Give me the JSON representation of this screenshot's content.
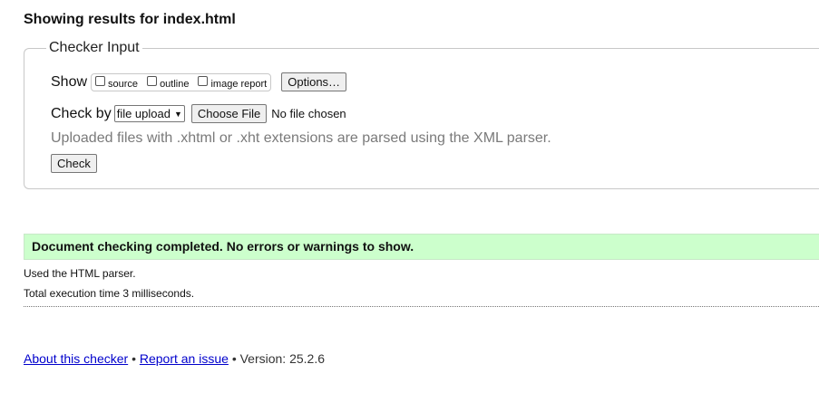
{
  "results_title": "Showing results for index.html",
  "checker_input": {
    "legend": "Checker Input",
    "show_label": "Show",
    "show_options": [
      {
        "label": "source",
        "checked": false
      },
      {
        "label": "outline",
        "checked": false
      },
      {
        "label": "image report",
        "checked": false
      }
    ],
    "options_button": "Options…",
    "check_by_label": "Check by",
    "check_by_selected": "file upload",
    "choose_file_button": "Choose File",
    "file_status": "No file chosen",
    "hint": "Uploaded files with .xhtml or .xht extensions are parsed using the XML parser.",
    "check_button": "Check"
  },
  "result": {
    "success_message": "Document checking completed. No errors or warnings to show.",
    "parser_info": "Used the HTML parser.",
    "execution_time": "Total execution time 3 milliseconds.",
    "success_color": "#ccffcc"
  },
  "footer": {
    "about_link": "About this checker",
    "separator_1": "•",
    "report_link": "Report an issue",
    "separator_2": "•",
    "version": "Version: 25.2.6",
    "link_color": "#0000cc"
  }
}
